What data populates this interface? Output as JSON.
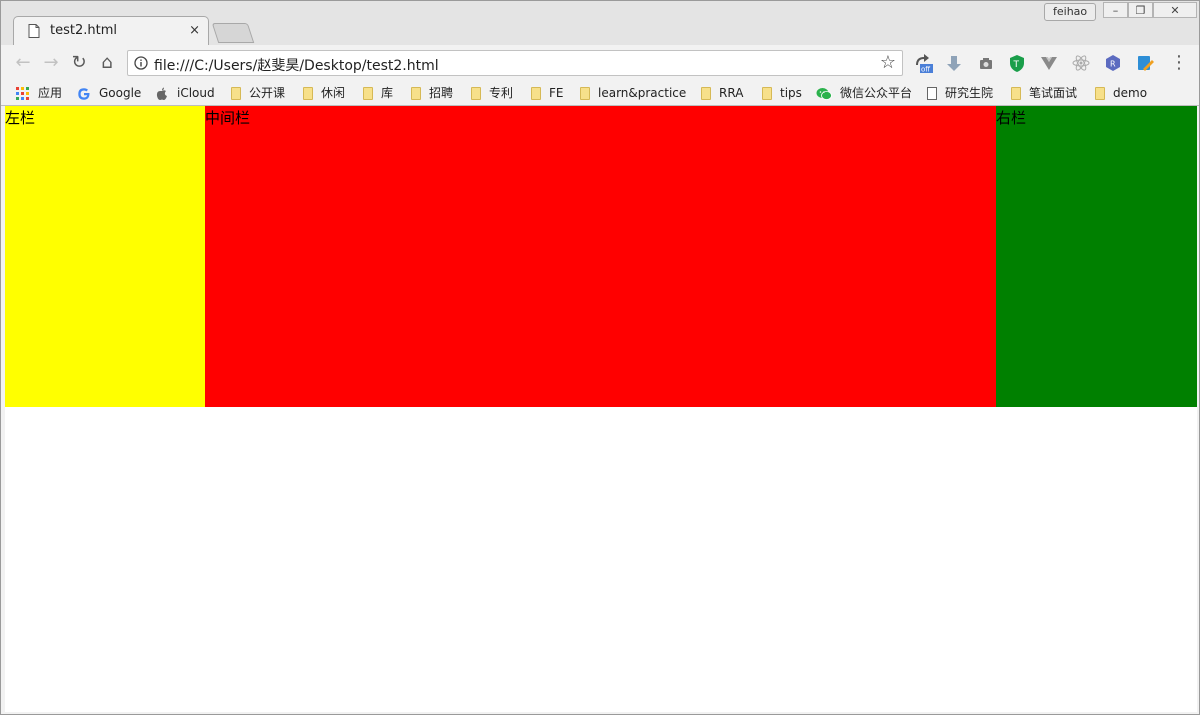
{
  "tab": {
    "title": "test2.html",
    "close": "×"
  },
  "window": {
    "profile": "feihao",
    "minimize": "–",
    "maximize": "❐",
    "close": "✕"
  },
  "toolbar": {
    "back": "←",
    "forward": "→",
    "reload": "↻",
    "home": "⌂",
    "url": "file:///C:/Users/赵斐昊/Desktop/test2.html",
    "star": "☆",
    "menu": "⋮"
  },
  "bookmarks": [
    {
      "label": "应用",
      "icon": "apps-grid-icon"
    },
    {
      "label": "Google",
      "icon": "google-icon"
    },
    {
      "label": "iCloud",
      "icon": "apple-icon"
    },
    {
      "label": "公开课",
      "icon": "folder-icon"
    },
    {
      "label": "休闲",
      "icon": "folder-icon"
    },
    {
      "label": "库",
      "icon": "folder-icon"
    },
    {
      "label": "招聘",
      "icon": "folder-icon"
    },
    {
      "label": "专利",
      "icon": "folder-icon"
    },
    {
      "label": "FE",
      "icon": "folder-icon"
    },
    {
      "label": "learn&practice",
      "icon": "folder-icon"
    },
    {
      "label": "RRA",
      "icon": "folder-icon"
    },
    {
      "label": "tips",
      "icon": "folder-icon"
    },
    {
      "label": "微信公众平台",
      "icon": "wechat-icon"
    },
    {
      "label": "研究生院",
      "icon": "page-icon"
    },
    {
      "label": "笔试面试",
      "icon": "folder-icon"
    },
    {
      "label": "demo",
      "icon": "folder-icon"
    }
  ],
  "page": {
    "left": "左栏",
    "center": "中间栏",
    "right": "右栏"
  },
  "colors": {
    "left": "#ffff00",
    "center": "#ff0000",
    "right": "#008000"
  }
}
